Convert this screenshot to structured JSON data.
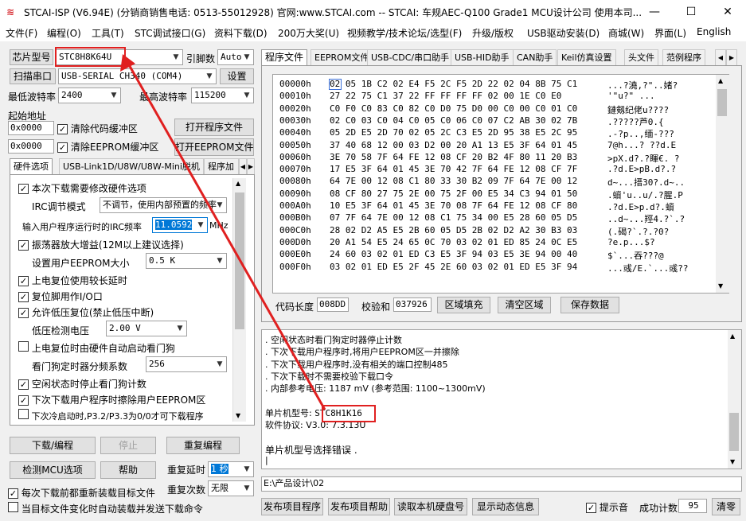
{
  "title": "STCAI-ISP (V6.94E) (分销商销售电话: 0513-55012928) 官网:www.STCAI.com  -- STCAI: 车规AEC-Q100 Grade1 MCU设计公司 使用本司...",
  "window": {
    "minimize": "—",
    "maximize": "☐",
    "close": "✕"
  },
  "menu": [
    "文件(F)",
    "编程(O)",
    "工具(T)",
    "STC调试接口(G)",
    "资料下载(D)",
    "200万大奖(U)",
    "视频教学/技术论坛/选型(F)",
    "升级/版权",
    "USB驱动安装(D)",
    "商城(W)",
    "界面(L)",
    "English"
  ],
  "left": {
    "chip_label": "芯片型号",
    "chip_value": "STC8H8K64U",
    "pin_label": "引脚数",
    "pin_value": "Auto",
    "scan_btn": "扫描串口",
    "port_value": "USB-SERIAL CH340 (COM4)",
    "settings_btn": "设置",
    "min_baud_label": "最低波特率",
    "min_baud_value": "2400",
    "max_baud_label": "最高波特率",
    "max_baud_value": "115200",
    "start_addr_label": "起始地址",
    "addr1": "0x0000",
    "clear_code": "清除代码缓冲区",
    "open_prog_btn": "打开程序文件",
    "addr2": "0x0000",
    "clear_eeprom": "清除EEPROM缓冲区",
    "open_eeprom_btn": "打开EEPROM文件",
    "tabs": [
      "硬件选项",
      "USB-Link1D/U8W/U8W-Mini脱机",
      "程序加"
    ],
    "hw": {
      "opt1": "本次下载需要修改硬件选项",
      "irc_mode_label": "IRC调节模式",
      "irc_mode_value": "不调节，使用内部预置的频率",
      "irc_freq_label": "输入用户程序运行时的IRC频率",
      "irc_freq_value": "11.0592",
      "irc_unit": "MHz",
      "opt2": "振荡器放大增益(12M以上建议选择)",
      "eeprom_size_label": "设置用户EEPROM大小",
      "eeprom_size_value": "0.5 K",
      "opt3": "上电复位使用较长延时",
      "opt4": "复位脚用作I/O口",
      "opt5": "允许低压复位(禁止低压中断)",
      "lvd_label": "低压检测电压",
      "lvd_value": "2.00 V",
      "opt6": "上电复位时由硬件自动启动看门狗",
      "wdt_label": "看门狗定时器分频系数",
      "wdt_value": "256",
      "opt7": "空闲状态时停止看门狗计数",
      "opt8": "下次下载用户程序时擦除用户EEPROM区",
      "opt9": "下次冷启动时,P3.2/P3.3为0/0才可下载程序"
    },
    "download_btn": "下载/编程",
    "stop_btn": "停止",
    "reprog_btn": "重复编程",
    "check_btn": "检测MCU选项",
    "help_btn": "帮助",
    "repeat_delay_label": "重复延时",
    "repeat_delay_value": "1 秒",
    "repeat_count_label": "重复次数",
    "repeat_count_value": "无限",
    "reload_each": "每次下载前都重新装载目标文件",
    "auto_reload": "当目标文件变化时自动装载并发送下载命令"
  },
  "right": {
    "tabs": [
      "程序文件",
      "EEPROM文件",
      "USB-CDC/串口助手",
      "USB-HID助手",
      "CAN助手",
      "Keil仿真设置",
      "头文件",
      "范例程序"
    ],
    "hex": [
      {
        "addr": "00000h",
        "bytes": "02 05 1B C2 02 E4 F5 2C F5 2D 22 02 04 8B 75 C1",
        "ascii": "...?澆,?\"..媎?"
      },
      {
        "addr": "00010h",
        "bytes": "27 22 75 C1 37 22 FF FF FF FF 02 00 1E C0 E0",
        "ascii": "'\"u?\"      ..."
      },
      {
        "addr": "00020h",
        "bytes": "C0 F0 C0 83 C0 82 C0 D0 75 D0 00 C0 00 C0 01 C0",
        "ascii": "鏈剱纪佬u????"
      },
      {
        "addr": "00030h",
        "bytes": "02 C0 03 C0 04 C0 05 C0 06 C0 07 C2 AB 30 02 7B",
        "ascii": ".?????芦0.{"
      },
      {
        "addr": "00040h",
        "bytes": "05 2D E5 2D 70 02 05 2C C3 E5 2D 95 38 E5 2C 95",
        "ascii": ".-?p..,缅-???"
      },
      {
        "addr": "00050h",
        "bytes": "37 40 68 12 00 03 D2 00 20 A1 13 E5 3F 64 01 45",
        "ascii": "7@h...? ??d.E"
      },
      {
        "addr": "00060h",
        "bytes": "3E 70 58 7F 64 FE 12 08 CF 20 B2 4F 80 11 20 B3",
        "ascii": ">pX.d?.?睴€. ?"
      },
      {
        "addr": "00070h",
        "bytes": "17 E5 3F 64 01 45 3E 70 42 7F 64 FE 12 08 CF 7F",
        "ascii": ".?d.E>pB.d?.?"
      },
      {
        "addr": "00080h",
        "bytes": "64 7E 00 12 08 C1 80 33 30 B2 09 7F 64 7E 00 12",
        "ascii": "d~...搢30?.d~.."
      },
      {
        "addr": "00090h",
        "bytes": "08 CF 80 27 75 2E 00 75 2F 00 E5 34 C3 94 01 50",
        "ascii": ".蠀'u..u/.?腥.P"
      },
      {
        "addr": "000A0h",
        "bytes": "10 E5 3F 64 01 45 3E 70 08 7F 64 FE 12 08 CF 80",
        "ascii": ".?d.E>p.d?.蠀"
      },
      {
        "addr": "000B0h",
        "bytes": "07 7F 64 7E 00 12 08 C1 75 34 00 E5 28 60 05 D5",
        "ascii": "..d~...羥4.?`.?"
      },
      {
        "addr": "000C0h",
        "bytes": "28 02 D2 A5 E5 2B 60 05 D5 2B 02 D2 A2 30 B3 03",
        "ascii": "(.碣?`.?.?0?"
      },
      {
        "addr": "000D0h",
        "bytes": "20 A1 54 E5 24 65 0C 70 03 02 01 ED 85 24 0C E5",
        "ascii": " ?e.p...$?"
      },
      {
        "addr": "000E0h",
        "bytes": "24 60 03 02 01 ED C3 E5 3F 94 03 E5 3E 94 00 40",
        "ascii": "$`...吞???@"
      },
      {
        "addr": "000F0h",
        "bytes": "03 02 01 ED E5 2F 45 2E 60 03 02 01 ED E5 3F 94",
        "ascii": "...彧/E.`...彧??"
      }
    ],
    "code_len_label": "代码长度",
    "code_len_value": "008DD",
    "checksum_label": "校验和",
    "checksum_value": "037926",
    "fill_btn": "区域填充",
    "clear_area_btn": "清空区域",
    "save_btn": "保存数据",
    "log": [
      "  . 空闲状态时看门狗定时器停止计数",
      "  . 下次下载用户程序时,将用户EEPROM区一并擦除",
      "  . 下次下载用户程序时,没有相关的端口控制485",
      "  . 下次下载时不需要校验下载口令",
      "  . 内部参考电压: 1187 mV (参考范围: 1100~1300mV)"
    ],
    "mcu_label": "  单片机型号:",
    "mcu_value": "STC8H1K16",
    "fw_line": "  软件协议: V3.0: 7.3.13U",
    "err_line": "单片机型号选择错误 .",
    "path": "E:\\产品设计\\02"
  },
  "bottom": {
    "publish_btn": "发布项目程序",
    "publish_help_btn": "发布项目帮助",
    "read_disk_btn": "读取本机硬盘号",
    "show_anim_btn": "显示动态信息",
    "beep_label": "提示音",
    "success_label": "成功计数",
    "success_value": "95",
    "clear_btn": "清零"
  },
  "colors": {
    "annotation": "#e02020",
    "selection": "#0078d7"
  }
}
